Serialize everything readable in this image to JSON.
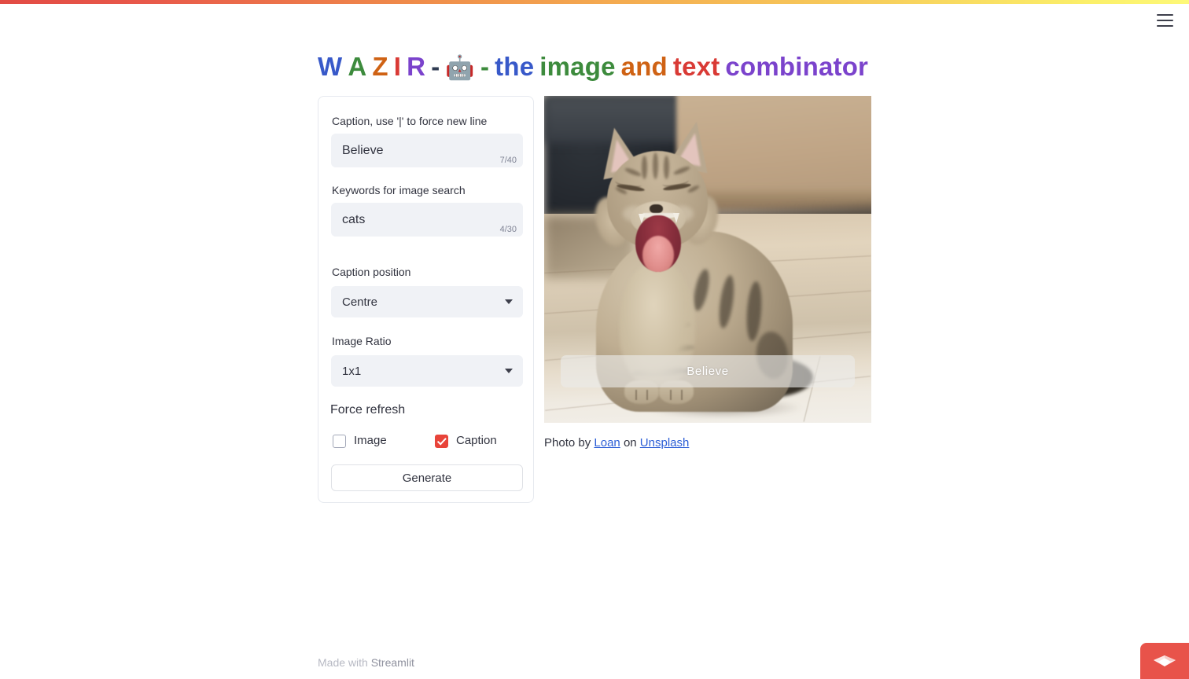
{
  "window": {
    "menu_icon": "hamburger-menu-icon",
    "gradient_colors": [
      "#e24b44",
      "#ef8a4a",
      "#f7cf5c",
      "#fdf878"
    ]
  },
  "title": {
    "w": "W",
    "a": "A",
    "z": "Z",
    "i": "I",
    "r": "R",
    "dash1": "-",
    "robot": "🤖",
    "dash2": "-",
    "the": "the",
    "image": "image",
    "and": "and",
    "text": "text",
    "combinator": "combinator",
    "colors": {
      "w": "#3859c9",
      "a": "#3d8b3d",
      "z": "#cf6214",
      "i": "#d93a35",
      "r": "#7b43cc",
      "the": "#3859c9",
      "image": "#3d8b3d",
      "and": "#cf6214",
      "text": "#d93a35",
      "combinator": "#7b43cc"
    }
  },
  "form": {
    "caption_field": {
      "label": "Caption, use '|' to force new line",
      "value": "Believe",
      "counter": "7/40",
      "max": 40
    },
    "keywords_field": {
      "label": "Keywords for image search",
      "value": "cats",
      "counter": "4/30",
      "max": 30
    },
    "caption_position": {
      "label": "Caption position",
      "selected": "Centre",
      "chevron": "chevron-down-icon"
    },
    "image_ratio": {
      "label": "Image Ratio",
      "selected": "1x1",
      "chevron": "chevron-down-icon"
    },
    "force_refresh": {
      "label": "Force refresh",
      "image_checkbox": {
        "label": "Image",
        "checked": false
      },
      "caption_checkbox": {
        "label": "Caption",
        "checked": true
      },
      "checked_color": "#e8443a"
    },
    "generate_button": {
      "label": "Generate"
    }
  },
  "result": {
    "image_alt": "yawning-tabby-kitten-photo",
    "caption_overlay": "Believe",
    "credit": {
      "prefix": "Photo by",
      "author": "Loan",
      "middle": "on",
      "source": "Unsplash",
      "link_color": "#2c5ed6"
    }
  },
  "footer": {
    "made_with": "Made with",
    "brand": "Streamlit"
  },
  "cloud_badge": {
    "icon": "streamlit-paper-boat-icon",
    "color": "#e8534a"
  }
}
